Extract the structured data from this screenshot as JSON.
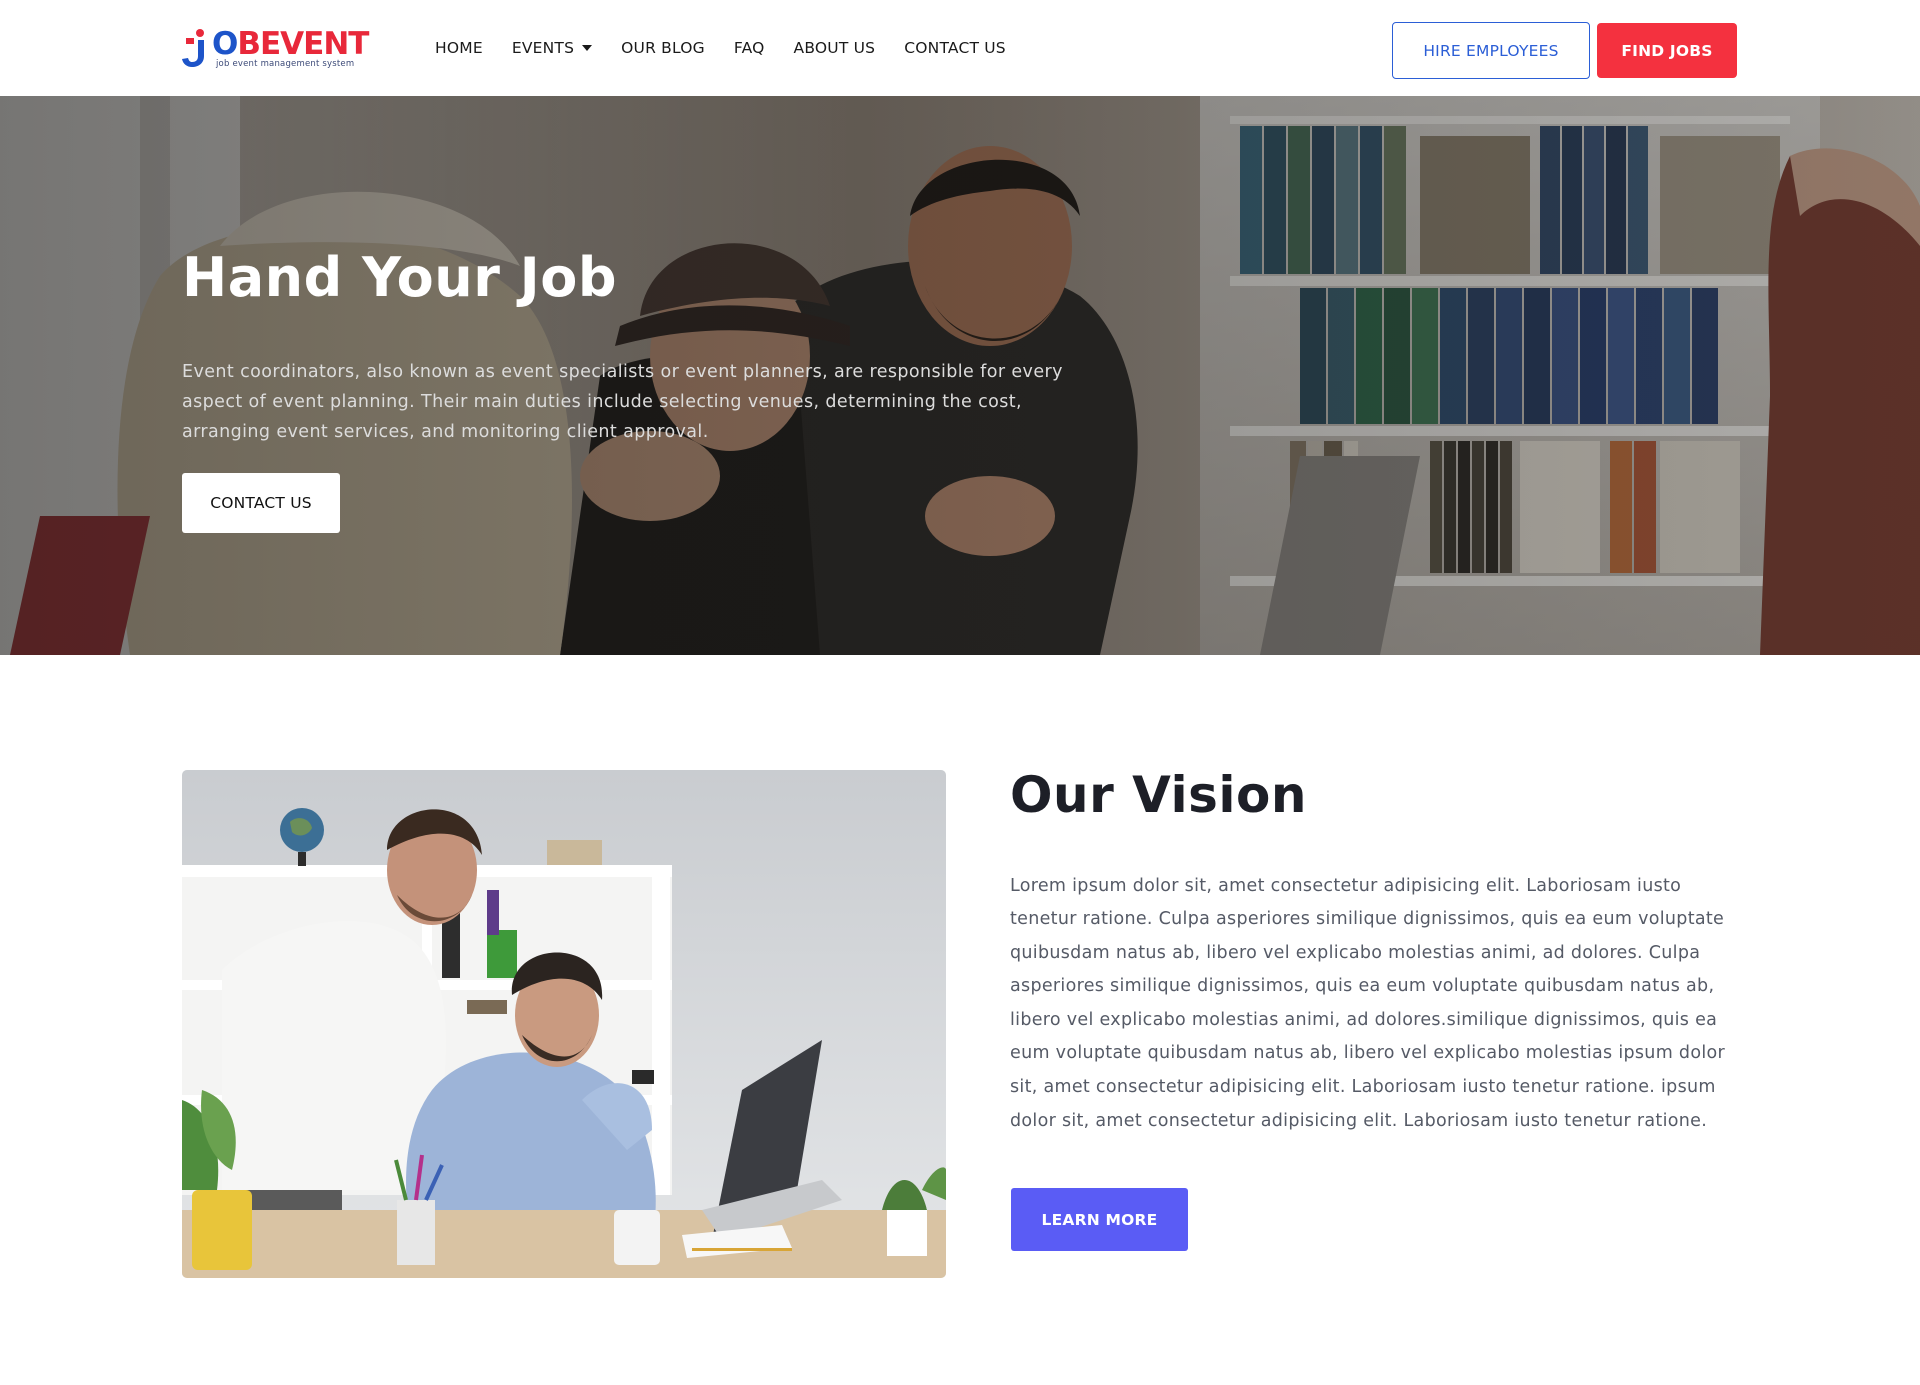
{
  "logo": {
    "mark": "J",
    "word_o": "O",
    "word_rest": "BEVENT",
    "tagline": "job event management system",
    "colors": {
      "blue": "#1d54c9",
      "red": "#e8283a"
    }
  },
  "nav": {
    "items": [
      {
        "label": "HOME"
      },
      {
        "label": "EVENTS",
        "dropdown": true
      },
      {
        "label": "OUR BLOG"
      },
      {
        "label": "FAQ"
      },
      {
        "label": "ABOUT US"
      },
      {
        "label": "CONTACT US"
      }
    ]
  },
  "header_buttons": {
    "hire_label": "HIRE EMPLOYEES",
    "find_label": "FIND JOBS",
    "hire_color": "#2b5ed6",
    "find_color": "#f4313f"
  },
  "hero": {
    "title": "Hand Your Job",
    "text": "Event coordinators, also known as event specialists or event planners, are responsible for every aspect of event planning. Their main duties include selecting venues, determining the cost, arranging event services, and monitoring client approval.",
    "button_label": "CONTACT US"
  },
  "vision": {
    "title": "Our Vision",
    "text": "Lorem ipsum dolor sit, amet consectetur adipisicing elit. Laboriosam iusto tenetur ratione. Culpa asperiores similique dignissimos, quis ea eum voluptate quibusdam natus ab, libero vel explicabo molestias animi, ad dolores. Culpa asperiores similique dignissimos, quis ea eum voluptate quibusdam natus ab, libero vel explicabo molestias animi, ad dolores.similique dignissimos, quis ea eum voluptate quibusdam natus ab, libero vel explicabo molestias ipsum dolor sit, amet consectetur adipisicing elit. Laboriosam iusto tenetur ratione. ipsum dolor sit, amet consectetur adipisicing elit. Laboriosam iusto tenetur ratione.",
    "button_label": "LEARN MORE",
    "button_color": "#5a5cf5"
  }
}
